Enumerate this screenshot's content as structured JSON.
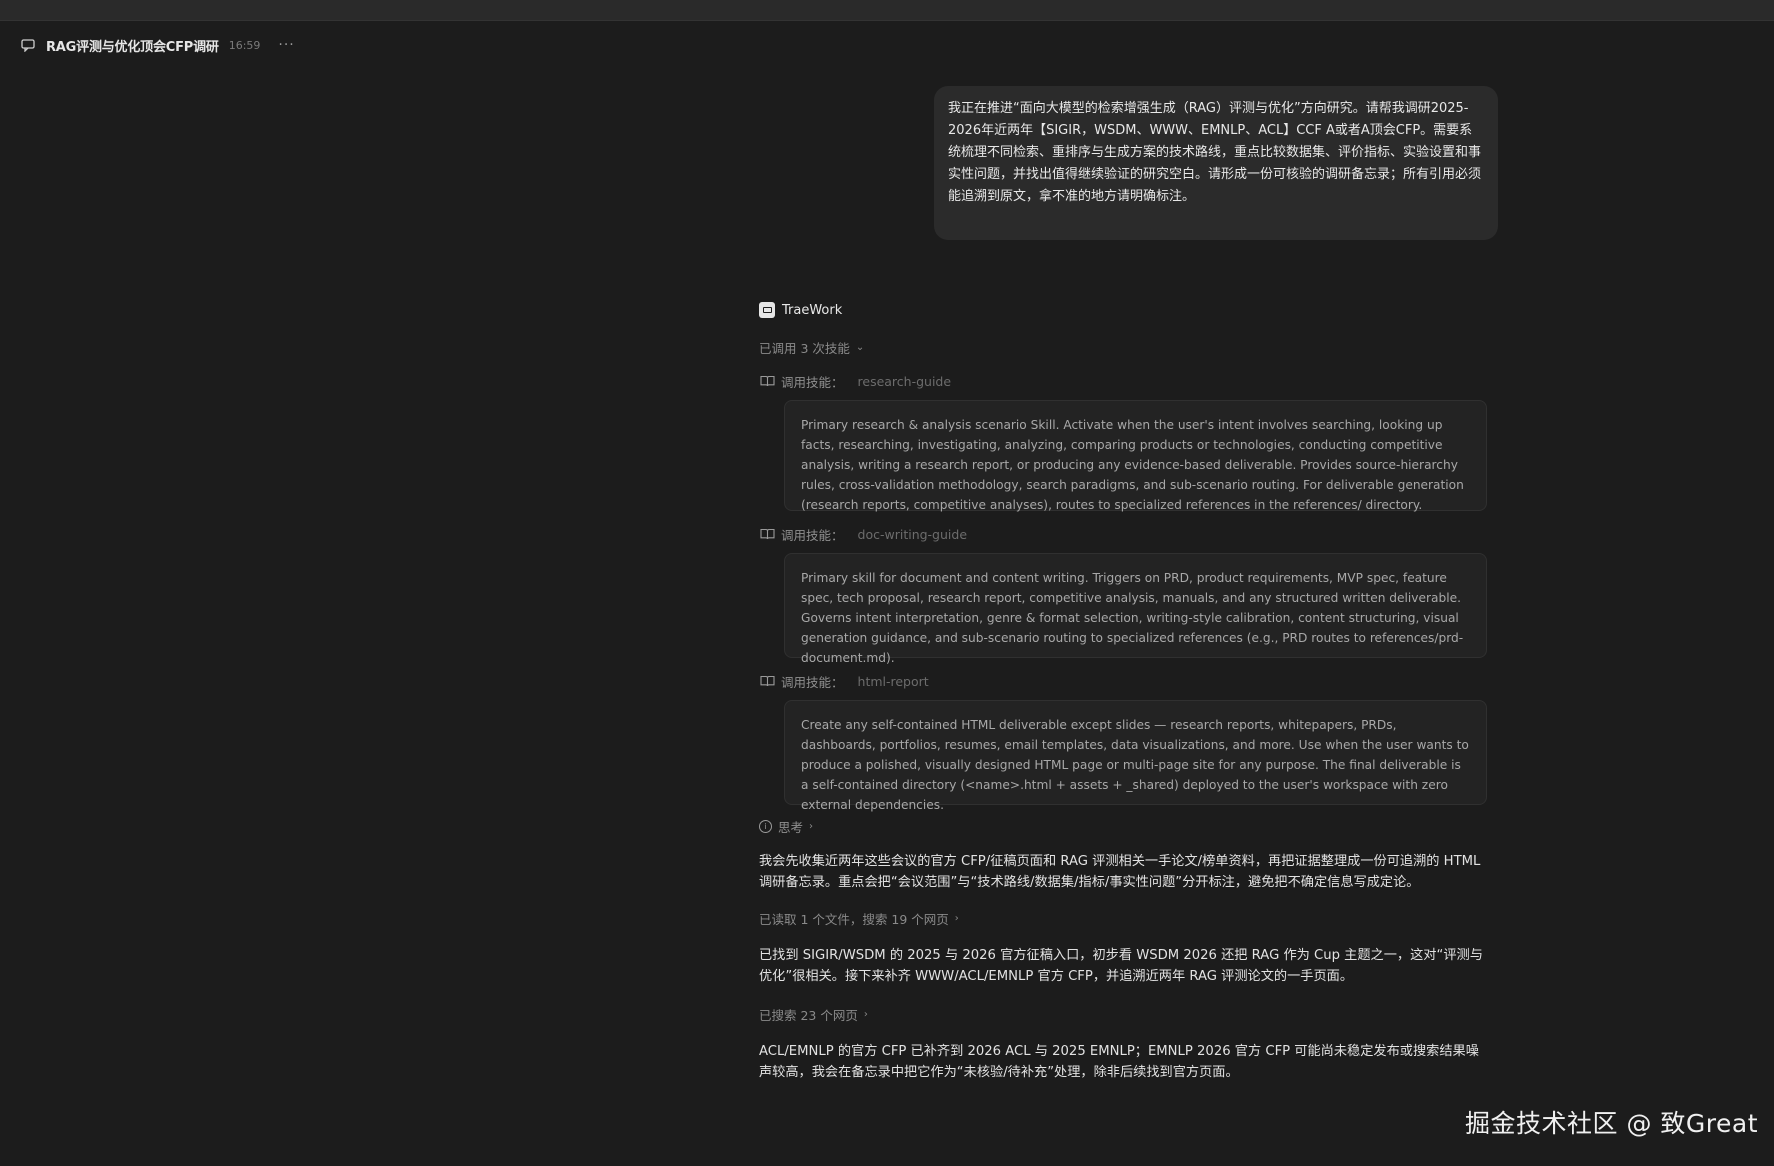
{
  "header": {
    "title": "RAG评测与优化顶会CFP调研",
    "time": "16:59",
    "more": "···"
  },
  "user_message": "我正在推进“面向大模型的检索增强生成（RAG）评测与优化”方向研究。请帮我调研2025-2026年近两年【SIGIR，WSDM、WWW、EMNLP、ACL】CCF A或者A顶会CFP。需要系统梳理不同检索、重排序与生成方案的技术路线，重点比较数据集、评价指标、实验设置和事实性问题，并找出值得继续验证的研究空白。请形成一份可核验的调研备忘录；所有引用必须能追溯到原文，拿不准的地方请明确标注。",
  "assistant": {
    "name": "TraeWork",
    "skills_summary": "已调用 3 次技能",
    "skills": [
      {
        "label": "调用技能：",
        "name": "research-guide",
        "description": "Primary research & analysis scenario Skill. Activate when the user's intent involves searching, looking up facts, researching, investigating, analyzing, comparing products or technologies, conducting competitive analysis, writing a research report, or producing any evidence-based deliverable. Provides source-hierarchy rules, cross-validation methodology, search paradigms, and sub-scenario routing. For deliverable generation (research reports, competitive analyses), routes to specialized references in the references/ directory."
      },
      {
        "label": "调用技能：",
        "name": "doc-writing-guide",
        "description": "Primary skill for document and content writing. Triggers on PRD, product requirements, MVP spec, feature spec, tech proposal, research report, competitive analysis, manuals, and any structured written deliverable. Governs intent interpretation, genre & format selection, writing-style calibration, content structuring, visual generation guidance, and sub-scenario routing to specialized references (e.g., PRD routes to references/prd-document.md)."
      },
      {
        "label": "调用技能：",
        "name": "html-report",
        "description": "Create any self-contained HTML deliverable except slides — research reports, whitepapers, PRDs, dashboards, portfolios, resumes, email templates, data visualizations, and more. Use when the user wants to produce a polished, visually designed HTML page or multi-page site for any purpose. The final deliverable is a self-contained directory (<name>.html + assets + _shared) deployed to the user's workspace with zero external dependencies."
      }
    ],
    "thinking_label": "思考",
    "para1": "我会先收集近两年这些会议的官方 CFP/征稿页面和 RAG 评测相关一手论文/榜单资料，再把证据整理成一份可追溯的 HTML 调研备忘录。重点会把“会议范围”与“技术路线/数据集/指标/事实性问题”分开标注，避免把不确定信息写成定论。",
    "status1": "已读取 1 个文件，搜索 19 个网页",
    "para2": "已找到 SIGIR/WSDM 的 2025 与 2026 官方征稿入口，初步看 WSDM 2026 还把 RAG 作为 Cup 主题之一，这对“评测与优化”很相关。接下来补齐 WWW/ACL/EMNLP 官方 CFP，并追溯近两年 RAG 评测论文的一手页面。",
    "status2": "已搜索 23 个网页",
    "para3": "ACL/EMNLP 的官方 CFP 已补齐到 2026 ACL 与 2025 EMNLP；EMNLP 2026 官方 CFP 可能尚未稳定发布或搜索结果噪声较高，我会在备忘录中把它作为“未核验/待补充”处理，除非后续找到官方页面。"
  },
  "watermark": "掘金技术社区 @ 致Great"
}
